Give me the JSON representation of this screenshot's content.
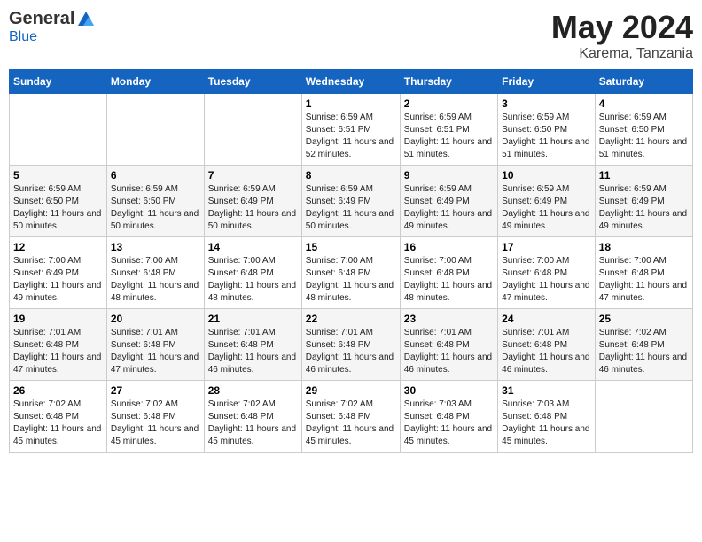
{
  "header": {
    "logo_general": "General",
    "logo_blue": "Blue",
    "month_year": "May 2024",
    "location": "Karema, Tanzania"
  },
  "days_of_week": [
    "Sunday",
    "Monday",
    "Tuesday",
    "Wednesday",
    "Thursday",
    "Friday",
    "Saturday"
  ],
  "weeks": [
    [
      {
        "day": "",
        "sunrise": "",
        "sunset": "",
        "daylight": ""
      },
      {
        "day": "",
        "sunrise": "",
        "sunset": "",
        "daylight": ""
      },
      {
        "day": "",
        "sunrise": "",
        "sunset": "",
        "daylight": ""
      },
      {
        "day": "1",
        "sunrise": "Sunrise: 6:59 AM",
        "sunset": "Sunset: 6:51 PM",
        "daylight": "Daylight: 11 hours and 52 minutes."
      },
      {
        "day": "2",
        "sunrise": "Sunrise: 6:59 AM",
        "sunset": "Sunset: 6:51 PM",
        "daylight": "Daylight: 11 hours and 51 minutes."
      },
      {
        "day": "3",
        "sunrise": "Sunrise: 6:59 AM",
        "sunset": "Sunset: 6:50 PM",
        "daylight": "Daylight: 11 hours and 51 minutes."
      },
      {
        "day": "4",
        "sunrise": "Sunrise: 6:59 AM",
        "sunset": "Sunset: 6:50 PM",
        "daylight": "Daylight: 11 hours and 51 minutes."
      }
    ],
    [
      {
        "day": "5",
        "sunrise": "Sunrise: 6:59 AM",
        "sunset": "Sunset: 6:50 PM",
        "daylight": "Daylight: 11 hours and 50 minutes."
      },
      {
        "day": "6",
        "sunrise": "Sunrise: 6:59 AM",
        "sunset": "Sunset: 6:50 PM",
        "daylight": "Daylight: 11 hours and 50 minutes."
      },
      {
        "day": "7",
        "sunrise": "Sunrise: 6:59 AM",
        "sunset": "Sunset: 6:49 PM",
        "daylight": "Daylight: 11 hours and 50 minutes."
      },
      {
        "day": "8",
        "sunrise": "Sunrise: 6:59 AM",
        "sunset": "Sunset: 6:49 PM",
        "daylight": "Daylight: 11 hours and 50 minutes."
      },
      {
        "day": "9",
        "sunrise": "Sunrise: 6:59 AM",
        "sunset": "Sunset: 6:49 PM",
        "daylight": "Daylight: 11 hours and 49 minutes."
      },
      {
        "day": "10",
        "sunrise": "Sunrise: 6:59 AM",
        "sunset": "Sunset: 6:49 PM",
        "daylight": "Daylight: 11 hours and 49 minutes."
      },
      {
        "day": "11",
        "sunrise": "Sunrise: 6:59 AM",
        "sunset": "Sunset: 6:49 PM",
        "daylight": "Daylight: 11 hours and 49 minutes."
      }
    ],
    [
      {
        "day": "12",
        "sunrise": "Sunrise: 7:00 AM",
        "sunset": "Sunset: 6:49 PM",
        "daylight": "Daylight: 11 hours and 49 minutes."
      },
      {
        "day": "13",
        "sunrise": "Sunrise: 7:00 AM",
        "sunset": "Sunset: 6:48 PM",
        "daylight": "Daylight: 11 hours and 48 minutes."
      },
      {
        "day": "14",
        "sunrise": "Sunrise: 7:00 AM",
        "sunset": "Sunset: 6:48 PM",
        "daylight": "Daylight: 11 hours and 48 minutes."
      },
      {
        "day": "15",
        "sunrise": "Sunrise: 7:00 AM",
        "sunset": "Sunset: 6:48 PM",
        "daylight": "Daylight: 11 hours and 48 minutes."
      },
      {
        "day": "16",
        "sunrise": "Sunrise: 7:00 AM",
        "sunset": "Sunset: 6:48 PM",
        "daylight": "Daylight: 11 hours and 48 minutes."
      },
      {
        "day": "17",
        "sunrise": "Sunrise: 7:00 AM",
        "sunset": "Sunset: 6:48 PM",
        "daylight": "Daylight: 11 hours and 47 minutes."
      },
      {
        "day": "18",
        "sunrise": "Sunrise: 7:00 AM",
        "sunset": "Sunset: 6:48 PM",
        "daylight": "Daylight: 11 hours and 47 minutes."
      }
    ],
    [
      {
        "day": "19",
        "sunrise": "Sunrise: 7:01 AM",
        "sunset": "Sunset: 6:48 PM",
        "daylight": "Daylight: 11 hours and 47 minutes."
      },
      {
        "day": "20",
        "sunrise": "Sunrise: 7:01 AM",
        "sunset": "Sunset: 6:48 PM",
        "daylight": "Daylight: 11 hours and 47 minutes."
      },
      {
        "day": "21",
        "sunrise": "Sunrise: 7:01 AM",
        "sunset": "Sunset: 6:48 PM",
        "daylight": "Daylight: 11 hours and 46 minutes."
      },
      {
        "day": "22",
        "sunrise": "Sunrise: 7:01 AM",
        "sunset": "Sunset: 6:48 PM",
        "daylight": "Daylight: 11 hours and 46 minutes."
      },
      {
        "day": "23",
        "sunrise": "Sunrise: 7:01 AM",
        "sunset": "Sunset: 6:48 PM",
        "daylight": "Daylight: 11 hours and 46 minutes."
      },
      {
        "day": "24",
        "sunrise": "Sunrise: 7:01 AM",
        "sunset": "Sunset: 6:48 PM",
        "daylight": "Daylight: 11 hours and 46 minutes."
      },
      {
        "day": "25",
        "sunrise": "Sunrise: 7:02 AM",
        "sunset": "Sunset: 6:48 PM",
        "daylight": "Daylight: 11 hours and 46 minutes."
      }
    ],
    [
      {
        "day": "26",
        "sunrise": "Sunrise: 7:02 AM",
        "sunset": "Sunset: 6:48 PM",
        "daylight": "Daylight: 11 hours and 45 minutes."
      },
      {
        "day": "27",
        "sunrise": "Sunrise: 7:02 AM",
        "sunset": "Sunset: 6:48 PM",
        "daylight": "Daylight: 11 hours and 45 minutes."
      },
      {
        "day": "28",
        "sunrise": "Sunrise: 7:02 AM",
        "sunset": "Sunset: 6:48 PM",
        "daylight": "Daylight: 11 hours and 45 minutes."
      },
      {
        "day": "29",
        "sunrise": "Sunrise: 7:02 AM",
        "sunset": "Sunset: 6:48 PM",
        "daylight": "Daylight: 11 hours and 45 minutes."
      },
      {
        "day": "30",
        "sunrise": "Sunrise: 7:03 AM",
        "sunset": "Sunset: 6:48 PM",
        "daylight": "Daylight: 11 hours and 45 minutes."
      },
      {
        "day": "31",
        "sunrise": "Sunrise: 7:03 AM",
        "sunset": "Sunset: 6:48 PM",
        "daylight": "Daylight: 11 hours and 45 minutes."
      },
      {
        "day": "",
        "sunrise": "",
        "sunset": "",
        "daylight": ""
      }
    ]
  ]
}
